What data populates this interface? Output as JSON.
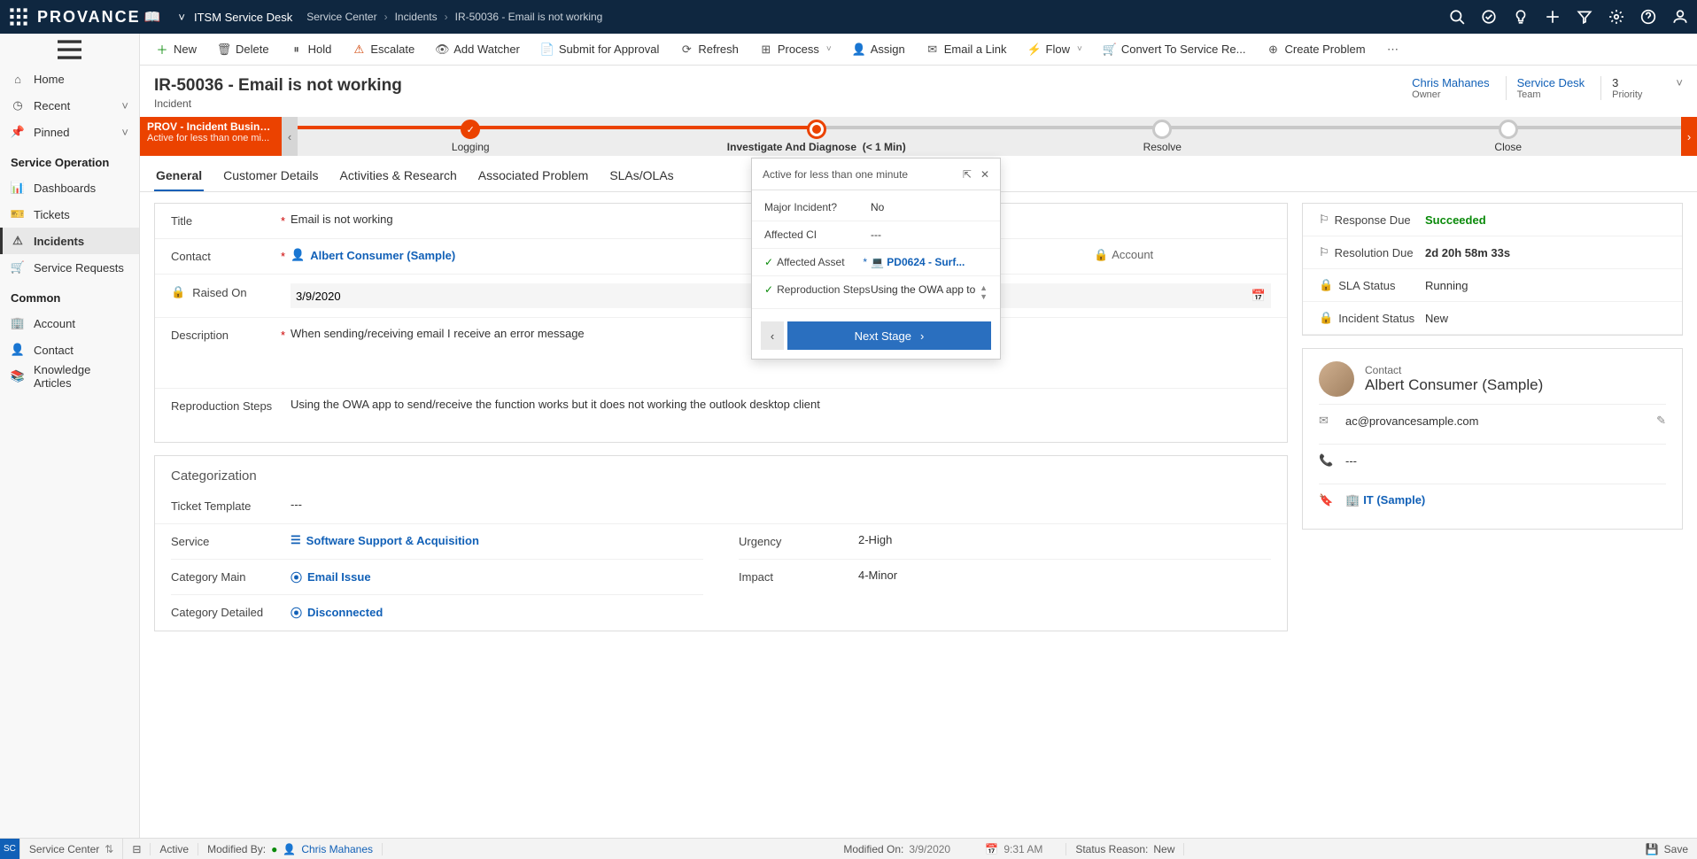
{
  "topbar": {
    "logo": "PROVANCE",
    "app_title": "ITSM Service Desk",
    "breadcrumb": [
      "Service Center",
      "Incidents",
      "IR-50036 - Email is not working"
    ]
  },
  "commandbar": {
    "new": "New",
    "delete": "Delete",
    "hold": "Hold",
    "escalate": "Escalate",
    "add_watcher": "Add Watcher",
    "submit_approval": "Submit for Approval",
    "refresh": "Refresh",
    "process": "Process",
    "assign": "Assign",
    "email_link": "Email a Link",
    "flow": "Flow",
    "convert": "Convert To Service Re...",
    "create_problem": "Create Problem"
  },
  "sidebar": {
    "items": [
      {
        "label": "Home",
        "icon": "home"
      },
      {
        "label": "Recent",
        "icon": "clock",
        "expand": true
      },
      {
        "label": "Pinned",
        "icon": "pin",
        "expand": true
      }
    ],
    "section1": "Service Operation",
    "svc_items": [
      {
        "label": "Dashboards",
        "icon": "dashboard"
      },
      {
        "label": "Tickets",
        "icon": "ticket"
      },
      {
        "label": "Incidents",
        "icon": "alert",
        "active": true
      },
      {
        "label": "Service Requests",
        "icon": "cart"
      }
    ],
    "section2": "Common",
    "common_items": [
      {
        "label": "Account",
        "icon": "building"
      },
      {
        "label": "Contact",
        "icon": "person"
      },
      {
        "label": "Knowledge Articles",
        "icon": "book"
      }
    ]
  },
  "header": {
    "title": "IR-50036 - Email is not working",
    "subtitle": "Incident",
    "cols": [
      {
        "value": "Chris Mahanes",
        "label": "Owner",
        "link": true
      },
      {
        "value": "Service Desk",
        "label": "Team",
        "link": true
      },
      {
        "value": "3",
        "label": "Priority",
        "link": false
      }
    ]
  },
  "bpf": {
    "pill_title": "PROV - Incident Business...",
    "pill_sub": "Active for less than one mi...",
    "stages": [
      {
        "label": "Logging",
        "state": "done"
      },
      {
        "label": "Investigate And Diagnose",
        "state": "current",
        "time": "(< 1 Min)"
      },
      {
        "label": "Resolve",
        "state": "future"
      },
      {
        "label": "Close",
        "state": "future"
      }
    ]
  },
  "tabs": [
    "General",
    "Customer Details",
    "Activities & Research",
    "Associated Problem",
    "SLAs/OLAs"
  ],
  "form": {
    "title_lbl": "Title",
    "title_val": "Email is not working",
    "contact_lbl": "Contact",
    "contact_val": "Albert Consumer (Sample)",
    "account_lbl": "Account",
    "raised_lbl": "Raised On",
    "raised_val": "3/9/2020",
    "desc_lbl": "Description",
    "desc_val": "When sending/receiving email I receive an error message",
    "repro_lbl": "Reproduction Steps",
    "repro_val": "Using the OWA app to send/receive the function works but it does not working the outlook desktop client",
    "cat_section": "Categorization",
    "tmpl_lbl": "Ticket Template",
    "tmpl_val": "---",
    "svc_lbl": "Service",
    "svc_val": "Software Support & Acquisition",
    "catmain_lbl": "Category Main",
    "catmain_val": "Email Issue",
    "catdet_lbl": "Category Detailed",
    "catdet_val": "Disconnected",
    "urg_lbl": "Urgency",
    "urg_val": "2-High",
    "imp_lbl": "Impact",
    "imp_val": "4-Minor"
  },
  "side_status": {
    "resp_lbl": "Response Due",
    "resp_val": "Succeeded",
    "res_lbl": "Resolution Due",
    "res_val": "2d 20h 58m 33s",
    "sla_lbl": "SLA Status",
    "sla_val": "Running",
    "inc_lbl": "Incident Status",
    "inc_val": "New"
  },
  "contact_card": {
    "label": "Contact",
    "name": "Albert Consumer (Sample)",
    "email": "ac@provancesample.com",
    "phone": "---",
    "group": "IT (Sample)"
  },
  "flyout": {
    "hdr": "Active for less than one minute",
    "major_lbl": "Major Incident?",
    "major_val": "No",
    "ci_lbl": "Affected CI",
    "ci_val": "---",
    "asset_lbl": "Affected Asset",
    "asset_val": "PD0624 - Surf...",
    "repro_lbl": "Reproduction Steps",
    "repro_val": "Using the OWA app to",
    "next": "Next Stage"
  },
  "statusbar": {
    "sc": "Service Center",
    "active": "Active",
    "modified_by_lbl": "Modified By:",
    "modified_by_val": "Chris Mahanes",
    "modified_on_lbl": "Modified On:",
    "modified_on_date": "3/9/2020",
    "modified_on_time": "9:31 AM",
    "status_reason_lbl": "Status Reason:",
    "status_reason_val": "New",
    "save": "Save"
  }
}
